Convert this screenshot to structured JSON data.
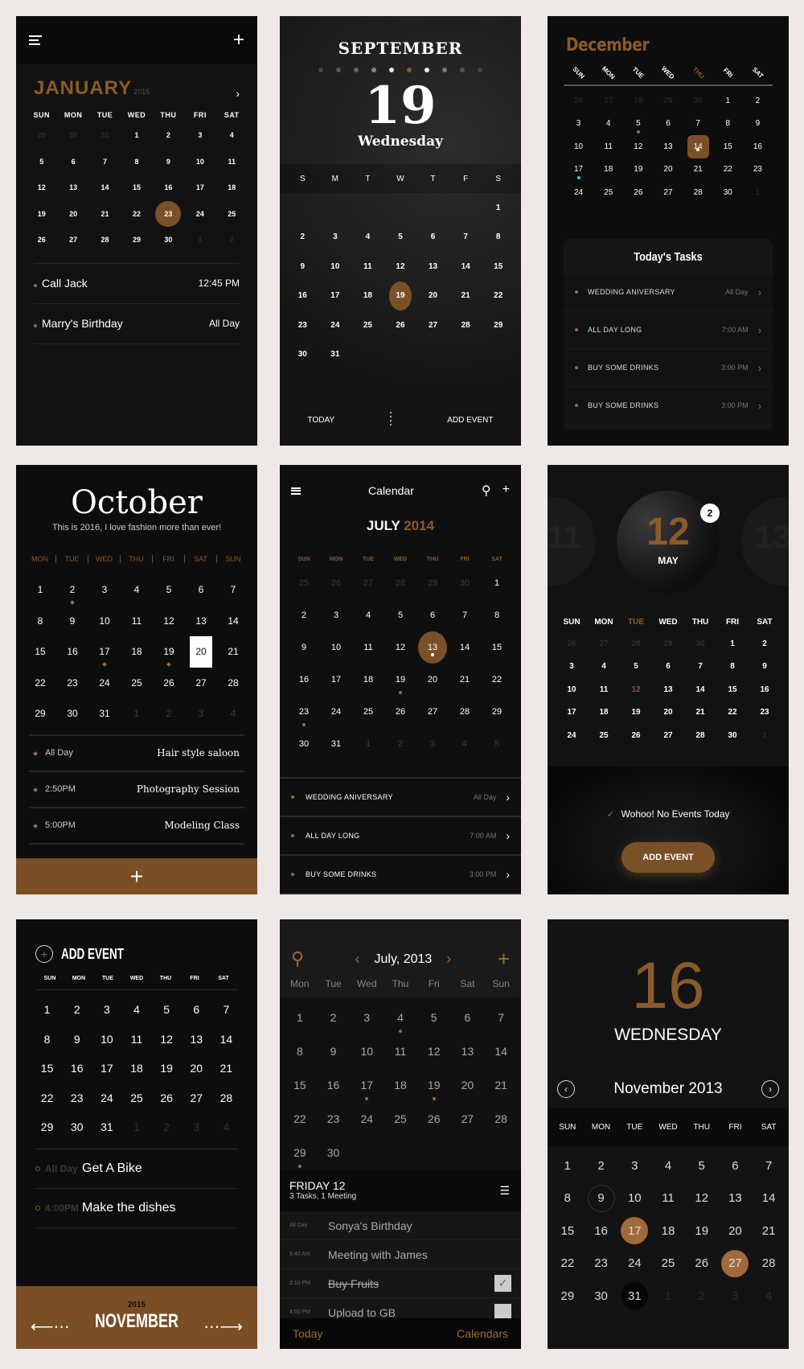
{
  "accent": "#8b5a2b",
  "panel1": {
    "month": "JANUARY",
    "year": "2015",
    "weekdays": [
      "SUN",
      "MON",
      "TUE",
      "WED",
      "THU",
      "FRI",
      "SAT"
    ],
    "days": [
      [
        "29",
        1
      ],
      [
        "30",
        1
      ],
      [
        "31",
        1
      ],
      [
        "1"
      ],
      [
        "2"
      ],
      [
        "3"
      ],
      [
        "4"
      ],
      [
        "5"
      ],
      [
        "6"
      ],
      [
        "7"
      ],
      [
        "8"
      ],
      [
        "9"
      ],
      [
        "10"
      ],
      [
        "11"
      ],
      [
        "12"
      ],
      [
        "13"
      ],
      [
        "14"
      ],
      [
        "15"
      ],
      [
        "16"
      ],
      [
        "17"
      ],
      [
        "18"
      ],
      [
        "19"
      ],
      [
        "20"
      ],
      [
        "21"
      ],
      [
        "22"
      ],
      [
        "23",
        0,
        "sel"
      ],
      [
        "24"
      ],
      [
        "25"
      ],
      [
        "26"
      ],
      [
        "27"
      ],
      [
        "28"
      ],
      [
        "29"
      ],
      [
        "30"
      ],
      [
        "1",
        1
      ],
      [
        "2",
        1
      ]
    ],
    "events": [
      {
        "name": "Call Jack",
        "time": "12:45 PM"
      },
      {
        "name": "Marry's Birthday",
        "time": "All Day"
      }
    ]
  },
  "panel2": {
    "month": "SEPTEMBER",
    "day": "19",
    "weekday": "Wednesday",
    "weekdays": [
      "S",
      "M",
      "T",
      "W",
      "T",
      "F",
      "S"
    ],
    "days": [
      [
        "",
        0
      ],
      [
        "",
        0
      ],
      [
        "",
        0
      ],
      [
        "",
        0
      ],
      [
        "",
        0
      ],
      [
        "",
        0
      ],
      [
        "1"
      ],
      [
        "2"
      ],
      [
        "3"
      ],
      [
        "4"
      ],
      [
        "5"
      ],
      [
        "6"
      ],
      [
        "7"
      ],
      [
        "8"
      ],
      [
        "9"
      ],
      [
        "10"
      ],
      [
        "11"
      ],
      [
        "12"
      ],
      [
        "13"
      ],
      [
        "14"
      ],
      [
        "15"
      ],
      [
        "16"
      ],
      [
        "17"
      ],
      [
        "18"
      ],
      [
        "19",
        0,
        "sel"
      ],
      [
        "20"
      ],
      [
        "21"
      ],
      [
        "22"
      ],
      [
        "23"
      ],
      [
        "24"
      ],
      [
        "25"
      ],
      [
        "26"
      ],
      [
        "27"
      ],
      [
        "28"
      ],
      [
        "29"
      ],
      [
        "30"
      ],
      [
        "31"
      ]
    ],
    "today_label": "TODAY",
    "add_label": "ADD EVENT"
  },
  "panel3": {
    "month": "December",
    "weekdays": [
      "SUN",
      "MON",
      "TUE",
      "WED",
      "THU",
      "FRI",
      "SAT"
    ],
    "highlight_weekday": 4,
    "days": [
      [
        "26",
        1
      ],
      [
        "27",
        1
      ],
      [
        "28",
        1
      ],
      [
        "29",
        1
      ],
      [
        "30",
        1
      ],
      [
        "1"
      ],
      [
        "2"
      ],
      [
        "3"
      ],
      [
        "4"
      ],
      [
        "5",
        0,
        "ev"
      ],
      [
        "6"
      ],
      [
        "7"
      ],
      [
        "8"
      ],
      [
        "9"
      ],
      [
        "10"
      ],
      [
        "11"
      ],
      [
        "12"
      ],
      [
        "13"
      ],
      [
        "14",
        0,
        "sel"
      ],
      [
        "15"
      ],
      [
        "16"
      ],
      [
        "17",
        0,
        "evc"
      ],
      [
        "18"
      ],
      [
        "19"
      ],
      [
        "20"
      ],
      [
        "21"
      ],
      [
        "22"
      ],
      [
        "23"
      ],
      [
        "24"
      ],
      [
        "25"
      ],
      [
        "26"
      ],
      [
        "27"
      ],
      [
        "28"
      ],
      [
        "30"
      ],
      [
        "1",
        1
      ]
    ],
    "tasks_title": "Today's Tasks",
    "tasks": [
      {
        "name": "WEDDING ANIVERSARY",
        "time": "All Day"
      },
      {
        "name": "ALL DAY LONG",
        "time": "7:00 AM"
      },
      {
        "name": "BUY SOME DRINKS",
        "time": "3:00 PM"
      },
      {
        "name": "BUY SOME DRINKS",
        "time": "3:00 PM"
      }
    ]
  },
  "panel4": {
    "month": "October",
    "subtitle": "This is 2016, I love fashion more than ever!",
    "weekdays": [
      "MON",
      "TUE",
      "WED",
      "THU",
      "FRI",
      "SAT",
      "SUN"
    ],
    "days": [
      [
        "1"
      ],
      [
        "2",
        0,
        "ev"
      ],
      [
        "3"
      ],
      [
        "4"
      ],
      [
        "5"
      ],
      [
        "6"
      ],
      [
        "7"
      ],
      [
        "8"
      ],
      [
        "9"
      ],
      [
        "10"
      ],
      [
        "11"
      ],
      [
        "12"
      ],
      [
        "13"
      ],
      [
        "14"
      ],
      [
        "15"
      ],
      [
        "16"
      ],
      [
        "17",
        0,
        "ev"
      ],
      [
        "18"
      ],
      [
        "19",
        0,
        "ev"
      ],
      [
        "20",
        0,
        "sel"
      ],
      [
        "21"
      ],
      [
        "22"
      ],
      [
        "23"
      ],
      [
        "24"
      ],
      [
        "25"
      ],
      [
        "26"
      ],
      [
        "27"
      ],
      [
        "28"
      ],
      [
        "29"
      ],
      [
        "30"
      ],
      [
        "31"
      ],
      [
        "1",
        1
      ],
      [
        "2",
        1
      ],
      [
        "3",
        1
      ],
      [
        "4",
        1
      ]
    ],
    "events": [
      {
        "time": "All Day",
        "name": "Hair style saloon"
      },
      {
        "time": "2:50PM",
        "name": "Photography Session"
      },
      {
        "time": "5:00PM",
        "name": "Modeling Class"
      }
    ],
    "add_icon": "+"
  },
  "panel5": {
    "title": "Calendar",
    "month": "JULY",
    "year": "2014",
    "weekdays": [
      "SUN",
      "MON",
      "TUE",
      "WED",
      "THU",
      "FRI",
      "SAT"
    ],
    "days": [
      [
        "25",
        1
      ],
      [
        "26",
        1
      ],
      [
        "27",
        1
      ],
      [
        "28",
        1
      ],
      [
        "29",
        1
      ],
      [
        "30",
        1
      ],
      [
        "1"
      ],
      [
        "2"
      ],
      [
        "3"
      ],
      [
        "4"
      ],
      [
        "5"
      ],
      [
        "6"
      ],
      [
        "7"
      ],
      [
        "8"
      ],
      [
        "9"
      ],
      [
        "10"
      ],
      [
        "11"
      ],
      [
        "12"
      ],
      [
        "13",
        0,
        "sel"
      ],
      [
        "14"
      ],
      [
        "15"
      ],
      [
        "16"
      ],
      [
        "17"
      ],
      [
        "18"
      ],
      [
        "19",
        0,
        "ev"
      ],
      [
        "20"
      ],
      [
        "21"
      ],
      [
        "22"
      ],
      [
        "23",
        0,
        "ev"
      ],
      [
        "24"
      ],
      [
        "25"
      ],
      [
        "26"
      ],
      [
        "27"
      ],
      [
        "28"
      ],
      [
        "29"
      ],
      [
        "30"
      ],
      [
        "31"
      ],
      [
        "1",
        1
      ],
      [
        "2",
        1
      ],
      [
        "3",
        1
      ],
      [
        "4",
        1
      ],
      [
        "5",
        1
      ]
    ],
    "events": [
      {
        "name": "WEDDING ANIVERSARY",
        "time": "All Day"
      },
      {
        "name": "ALL DAY LONG",
        "time": "7:00 AM"
      },
      {
        "name": "BUY SOME DRINKS",
        "time": "3:00 PM"
      }
    ]
  },
  "panel6": {
    "day": "12",
    "month": "MAY",
    "badge": "2",
    "prev_day": "11",
    "next_day": "13",
    "weekdays": [
      "SUN",
      "MON",
      "TUE",
      "WED",
      "THU",
      "FRI",
      "SAT"
    ],
    "highlight_weekday": 2,
    "days": [
      [
        "26",
        1
      ],
      [
        "27",
        1
      ],
      [
        "28",
        1
      ],
      [
        "29",
        1
      ],
      [
        "30",
        1
      ],
      [
        "1"
      ],
      [
        "2"
      ],
      [
        "3"
      ],
      [
        "4"
      ],
      [
        "5"
      ],
      [
        "6"
      ],
      [
        "7"
      ],
      [
        "8"
      ],
      [
        "9"
      ],
      [
        "10"
      ],
      [
        "11"
      ],
      [
        "12",
        0,
        "acc"
      ],
      [
        "13"
      ],
      [
        "14"
      ],
      [
        "15"
      ],
      [
        "16"
      ],
      [
        "17"
      ],
      [
        "18"
      ],
      [
        "19"
      ],
      [
        "20"
      ],
      [
        "21"
      ],
      [
        "22"
      ],
      [
        "23"
      ],
      [
        "24"
      ],
      [
        "25"
      ],
      [
        "26"
      ],
      [
        "27"
      ],
      [
        "28"
      ],
      [
        "30"
      ],
      [
        "1",
        1
      ]
    ],
    "message": "Wohoo! No Events Today",
    "add_label": "ADD EVENT"
  },
  "panel7": {
    "title": "ADD EVENT",
    "weekdays": [
      "SUN",
      "MON",
      "TUE",
      "WED",
      "THU",
      "FRI",
      "SAT"
    ],
    "days": [
      [
        "1"
      ],
      [
        "2"
      ],
      [
        "3"
      ],
      [
        "4"
      ],
      [
        "5"
      ],
      [
        "6"
      ],
      [
        "7"
      ],
      [
        "8"
      ],
      [
        "9"
      ],
      [
        "10"
      ],
      [
        "11"
      ],
      [
        "12"
      ],
      [
        "13"
      ],
      [
        "14"
      ],
      [
        "15"
      ],
      [
        "16"
      ],
      [
        "17"
      ],
      [
        "18"
      ],
      [
        "19"
      ],
      [
        "20"
      ],
      [
        "21"
      ],
      [
        "22"
      ],
      [
        "23"
      ],
      [
        "24"
      ],
      [
        "25"
      ],
      [
        "26"
      ],
      [
        "27"
      ],
      [
        "28"
      ],
      [
        "29"
      ],
      [
        "30"
      ],
      [
        "31"
      ],
      [
        "1",
        1
      ],
      [
        "2",
        1
      ],
      [
        "3",
        1
      ],
      [
        "4",
        1
      ]
    ],
    "events": [
      {
        "time": "All Day",
        "name": "Get A Bike"
      },
      {
        "time": "4:00PM",
        "name": "Make the dishes"
      }
    ],
    "year": "2015",
    "month": "NOVEMBER"
  },
  "panel8": {
    "month_label": "July, 2013",
    "weekdays": [
      "Mon",
      "Tue",
      "Wed",
      "Thu",
      "Fri",
      "Sat",
      "Sun"
    ],
    "days": [
      [
        "1"
      ],
      [
        "2"
      ],
      [
        "3"
      ],
      [
        "4",
        0,
        "ev"
      ],
      [
        "5"
      ],
      [
        "6"
      ],
      [
        "7"
      ],
      [
        "8"
      ],
      [
        "9"
      ],
      [
        "10"
      ],
      [
        "11"
      ],
      [
        "12"
      ],
      [
        "13"
      ],
      [
        "14"
      ],
      [
        "15"
      ],
      [
        "16"
      ],
      [
        "17",
        0,
        "ev"
      ],
      [
        "18"
      ],
      [
        "19",
        0,
        "ev"
      ],
      [
        "20"
      ],
      [
        "21"
      ],
      [
        "22"
      ],
      [
        "23"
      ],
      [
        "24"
      ],
      [
        "25"
      ],
      [
        "26"
      ],
      [
        "27"
      ],
      [
        "28"
      ],
      [
        "29",
        0,
        "ev"
      ],
      [
        "30"
      ]
    ],
    "day_title": "FRIDAY 12",
    "day_summary": "3 Tasks, 1 Meeting",
    "items": [
      {
        "time": "All Day",
        "name": "Sonya's Birthday",
        "check": null
      },
      {
        "time": "9:40 AM",
        "name": "Meeting with James",
        "check": null
      },
      {
        "time": "2:10 PM",
        "name": "Buy Fruits",
        "check": true
      },
      {
        "time": "4:00 PM",
        "name": "Upload to GB",
        "check": false
      }
    ],
    "tab_today": "Today",
    "tab_calendars": "Calendars"
  },
  "panel9": {
    "day": "16",
    "weekday": "WEDNESDAY",
    "month_label": "November 2013",
    "weekdays": [
      "SUN",
      "MON",
      "TUE",
      "WED",
      "THU",
      "FRI",
      "SAT"
    ],
    "days": [
      [
        "1"
      ],
      [
        "2"
      ],
      [
        "3"
      ],
      [
        "4"
      ],
      [
        "5"
      ],
      [
        "6"
      ],
      [
        "7"
      ],
      [
        "8"
      ],
      [
        "9",
        0,
        "ring"
      ],
      [
        "10"
      ],
      [
        "11"
      ],
      [
        "12"
      ],
      [
        "13"
      ],
      [
        "14"
      ],
      [
        "15"
      ],
      [
        "16"
      ],
      [
        "17",
        0,
        "fill"
      ],
      [
        "18"
      ],
      [
        "19"
      ],
      [
        "20"
      ],
      [
        "21"
      ],
      [
        "22"
      ],
      [
        "23"
      ],
      [
        "24"
      ],
      [
        "25"
      ],
      [
        "26"
      ],
      [
        "27",
        0,
        "fill"
      ],
      [
        "28"
      ],
      [
        "29"
      ],
      [
        "30"
      ],
      [
        "31",
        0,
        "dark"
      ],
      [
        "1",
        1
      ],
      [
        "2",
        1
      ],
      [
        "3",
        1
      ],
      [
        "4",
        1
      ]
    ]
  }
}
